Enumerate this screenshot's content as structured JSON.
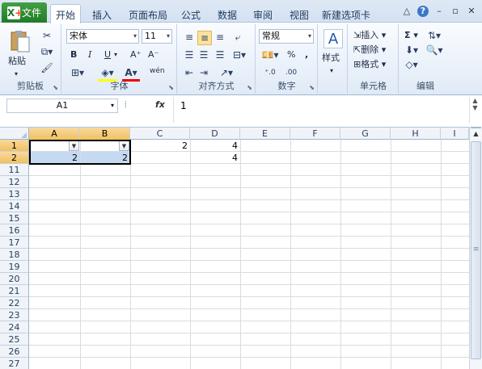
{
  "tabs": {
    "file": "文件",
    "home": "开始",
    "insert": "插入",
    "page_layout": "页面布局",
    "formulas": "公式",
    "data": "数据",
    "review": "审阅",
    "view": "视图",
    "new_tab": "新建选项卡"
  },
  "window_controls": {
    "collapse": "△",
    "help": "?",
    "minimize": "–",
    "restore": "▫",
    "close": "✕"
  },
  "ribbon": {
    "clipboard": {
      "paste": "粘贴",
      "label": "剪贴板"
    },
    "font": {
      "name": "宋体",
      "size": "11",
      "bold": "B",
      "italic": "I",
      "underline": "U",
      "grow": "A⁺",
      "shrink": "A⁻",
      "wen": "wén",
      "label": "字体"
    },
    "alignment": {
      "label": "对齐方式"
    },
    "number": {
      "format": "常规",
      "percent": "%",
      "comma": ",",
      "label": "数字"
    },
    "styles": {
      "label": "样式"
    },
    "cells": {
      "insert": "插入",
      "delete": "删除",
      "format": "格式",
      "label": "单元格"
    },
    "editing": {
      "sum": "Σ",
      "label": "编辑"
    }
  },
  "formula_bar": {
    "name_box": "A1",
    "fx": "fx",
    "content": "1"
  },
  "grid": {
    "columns": [
      "A",
      "B",
      "C",
      "D",
      "E",
      "F",
      "G",
      "H",
      "I"
    ],
    "rows": [
      "1",
      "2",
      "11",
      "12",
      "13",
      "14",
      "15",
      "16",
      "17",
      "18",
      "19",
      "20",
      "21",
      "22",
      "23",
      "24",
      "25",
      "26",
      "27"
    ],
    "cells": {
      "C1": "2",
      "D1": "4",
      "A2": "2",
      "B2": "2",
      "D2": "4"
    }
  }
}
